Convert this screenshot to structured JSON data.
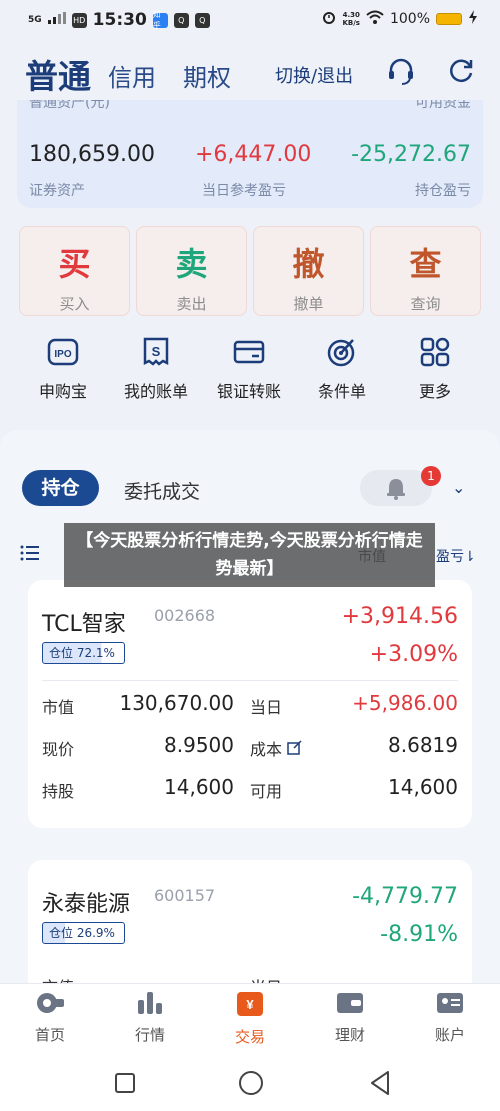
{
  "status": {
    "signal": "5G",
    "time": "15:30",
    "apps": [
      "知乎",
      "Q",
      "Q"
    ],
    "speed_top": "4.30",
    "speed_bottom": "KB/s",
    "battery": "100%"
  },
  "header": {
    "tab_normal": "普通",
    "tab_credit": "信用",
    "tab_option": "期权",
    "switch": "切换/退出"
  },
  "asset": {
    "cut_left": "普通资产(元)",
    "cut_right": "可用资金",
    "total": "180,659.00",
    "total_label": "证券资产",
    "daily": "+6,447.00",
    "daily_label": "当日参考盈亏",
    "hold": "-25,272.67",
    "hold_label": "持仓盈亏"
  },
  "trade": [
    {
      "big": "买",
      "small": "买入"
    },
    {
      "big": "卖",
      "small": "卖出"
    },
    {
      "big": "撤",
      "small": "撤单"
    },
    {
      "big": "查",
      "small": "查询"
    }
  ],
  "quick": [
    "申购宝",
    "我的账单",
    "银证转账",
    "条件单",
    "更多"
  ],
  "panel": {
    "pos_tab": "持仓",
    "order_tab": "委托成交",
    "badge": "1",
    "col_value": "市值",
    "col_pnl": "盈亏"
  },
  "overlay": "【今天股票分析行情走势,今天股票分析行情走势最新】",
  "stocks": [
    {
      "name": "TCL智家",
      "code": "002668",
      "pnl": "+3,914.56",
      "pnl_pct": "+3.09%",
      "ratio": "仓位  72.1%",
      "ratio_value": 72.1,
      "mv_label": "市值",
      "mv": "130,670.00",
      "day_label": "当日",
      "day": "+5,986.00",
      "price_label": "现价",
      "price": "8.9500",
      "cost_label": "成本",
      "cost": "8.6819",
      "hold_label": "持股",
      "hold": "14,600",
      "avail_label": "可用",
      "avail": "14,600"
    },
    {
      "name": "永泰能源",
      "code": "600157",
      "pnl": "-4,779.77",
      "pnl_pct": "-8.91%",
      "ratio": "仓位  26.9%",
      "ratio_value": 26.9,
      "mv_label": "市值",
      "day_label": "当日"
    }
  ],
  "nav": [
    "首页",
    "行情",
    "交易",
    "理财",
    "账户"
  ]
}
